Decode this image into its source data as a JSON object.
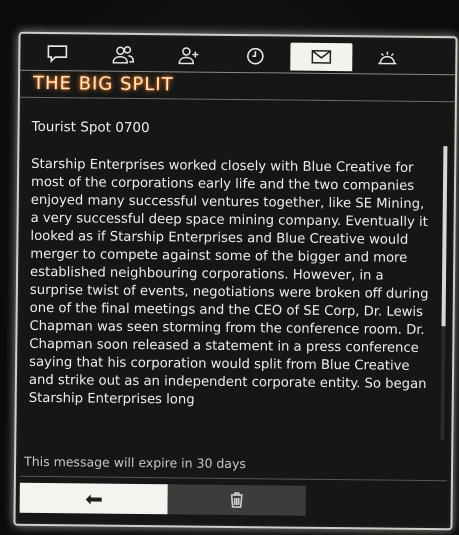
{
  "tabs": [
    {
      "icon": "chat-bubble-icon",
      "active": false
    },
    {
      "icon": "contacts-icon",
      "active": false
    },
    {
      "icon": "add-contact-icon",
      "active": false
    },
    {
      "icon": "clock-icon",
      "active": false
    },
    {
      "icon": "envelope-icon",
      "active": true
    },
    {
      "icon": "settings-hand-icon",
      "active": false
    }
  ],
  "message": {
    "title": "THE BIG SPLIT",
    "sender": "Tourist Spot 0700",
    "body": "Starship Enterprises worked closely with Blue Creative for most of the corporations early life and the two companies enjoyed many successful ventures together, like SE Mining, a very successful deep space mining company. Eventually it looked as if Starship Enterprises and Blue Creative would merger to compete against some of the bigger and more established neighbouring corporations. However, in a surprise twist of events, negotiations were broken off during one of the final meetings and the CEO of SE Corp, Dr. Lewis Chapman was seen storming from the conference room. Dr. Chapman soon released a statement in a press conference saying that his corporation would split from Blue Creative and strike out as an independent corporate entity. So began Starship Enterprises long",
    "expiry": "This message will expire in 30 days"
  },
  "colors": {
    "title_glow": "#ff8a2a",
    "panel_border": "#cfcfc8",
    "active_tab": "#f3f3ee"
  }
}
